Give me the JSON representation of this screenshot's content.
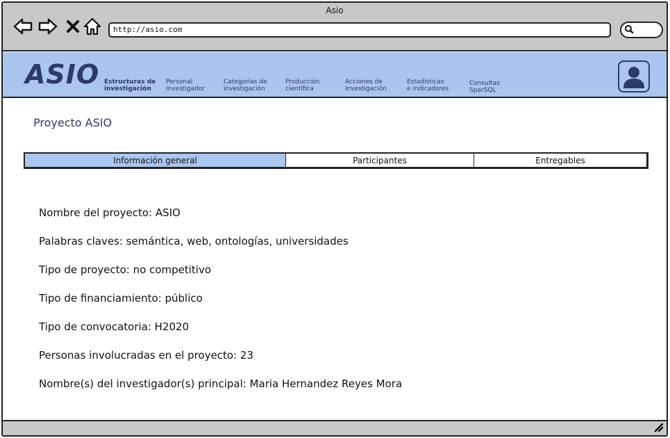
{
  "window": {
    "title": "Asio"
  },
  "browser": {
    "url": "http://asio.com",
    "icons": [
      "back-arrow-icon",
      "forward-arrow-icon",
      "close-x-icon",
      "home-icon",
      "search-icon"
    ]
  },
  "header": {
    "logo": "ASIO",
    "nav": [
      {
        "line1": "Estructuras de",
        "line2": "investigación",
        "active": true
      },
      {
        "line1": "Personal",
        "line2": "investigador",
        "active": false
      },
      {
        "line1": "Categorías de",
        "line2": "investigación",
        "active": false
      },
      {
        "line1": "Producción",
        "line2": "científica",
        "active": false
      },
      {
        "line1": "Acciones de",
        "line2": "investigación",
        "active": false
      },
      {
        "line1": "Estadísticas",
        "line2": "e indicadores",
        "active": false
      },
      {
        "line1": "Consultas",
        "line2": "SparSQL",
        "active": false
      }
    ],
    "accent_color": "#aac5ee",
    "text_color": "#2c3a6e"
  },
  "main": {
    "title": "Proyecto ASIO",
    "tabs": [
      {
        "label": "Información general",
        "active": true
      },
      {
        "label": "Participantes",
        "active": false
      },
      {
        "label": "Entregables",
        "active": false
      }
    ],
    "info": [
      "Nombre del proyecto: ASIO",
      "Palabras claves: semántica, web, ontologías, universidades",
      "Tipo de proyecto: no competitivo",
      "Tipo de financiamiento: público",
      "Tipo de convocatoria: H2020",
      "Personas involucradas en el proyecto: 23",
      "Nombre(s) del investigador(s) principal: Maria Hernandez Reyes Mora"
    ]
  }
}
